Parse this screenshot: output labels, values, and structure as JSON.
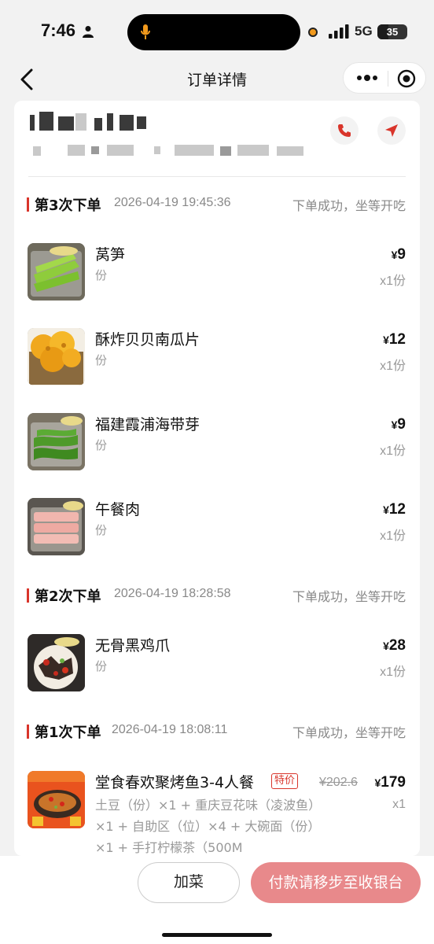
{
  "status_bar": {
    "time": "7:46",
    "network": "5G",
    "battery": "35",
    "icons": [
      "person-icon",
      "mic-icon",
      "recording-dot-icon",
      "signal-icon",
      "battery-icon"
    ]
  },
  "nav": {
    "title": "订单详情",
    "icons": [
      "chevron-left-icon",
      "more-dots-icon",
      "target-icon"
    ]
  },
  "store": {
    "icons": [
      "phone-icon",
      "navigation-arrow-icon"
    ]
  },
  "colors": {
    "accent": "#d9352b",
    "pay_button": "#e8898b",
    "page_bg": "#f2f2f2",
    "muted_text": "#999999"
  },
  "batches": [
    {
      "title": "第3次下单",
      "time": "2026-04-19 19:45:36",
      "status": "下单成功，坐等开吃",
      "items": [
        {
          "name": "莴笋",
          "unit": "份",
          "yen": "¥",
          "price": "9",
          "qty": "x1份"
        },
        {
          "name": "酥炸贝贝南瓜片",
          "unit": "份",
          "yen": "¥",
          "price": "12",
          "qty": "x1份"
        },
        {
          "name": "福建霞浦海带芽",
          "unit": "份",
          "yen": "¥",
          "price": "9",
          "qty": "x1份"
        },
        {
          "name": "午餐肉",
          "unit": "份",
          "yen": "¥",
          "price": "12",
          "qty": "x1份"
        }
      ]
    },
    {
      "title": "第2次下单",
      "time": "2026-04-19 18:28:58",
      "status": "下单成功，坐等开吃",
      "items": [
        {
          "name": "无骨黑鸡爪",
          "unit": "份",
          "yen": "¥",
          "price": "28",
          "qty": "x1份"
        }
      ]
    },
    {
      "title": "第1次下单",
      "time": "2026-04-19 18:08:11",
      "status": "下单成功，坐等开吃",
      "items": [
        {
          "name": "堂食春欢聚烤鱼3-4人餐",
          "tag": "特价",
          "original_price": "¥202.6",
          "yen": "¥",
          "price": "179",
          "qty": "x1",
          "description": "土豆（份）×1 + 重庆豆花味（凌波鱼）×1 + 自助区（位）×4 + 大碗面（份）×1 + 手打柠檬茶（500M"
        }
      ]
    }
  ],
  "bottom_bar": {
    "add_label": "加菜",
    "pay_label": "付款请移步至收银台"
  }
}
